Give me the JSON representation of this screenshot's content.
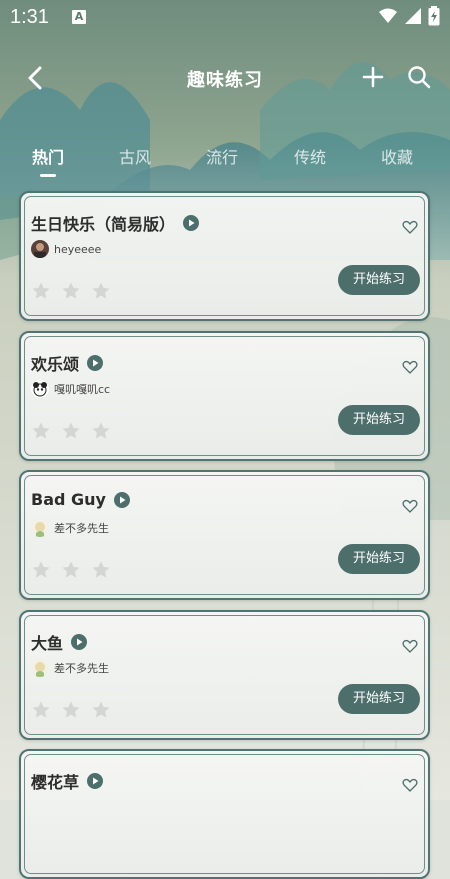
{
  "status_bar": {
    "time": "1:31",
    "notification_icon": "A"
  },
  "header": {
    "title": "趣味练习"
  },
  "tabs": [
    {
      "label": "热门",
      "active": true
    },
    {
      "label": "古风",
      "active": false
    },
    {
      "label": "流行",
      "active": false
    },
    {
      "label": "传统",
      "active": false
    },
    {
      "label": "收藏",
      "active": false
    }
  ],
  "cards": [
    {
      "title": "生日快乐（简易版）",
      "author": "heyeeee",
      "rating": 0,
      "button": "开始练习"
    },
    {
      "title": "欢乐颂",
      "author": "嘎叽嘎叽cc",
      "rating": 0,
      "button": "开始练习"
    },
    {
      "title": "Bad Guy",
      "author": "差不多先生",
      "rating": 0,
      "button": "开始练习"
    },
    {
      "title": "大鱼",
      "author": "差不多先生",
      "rating": 0,
      "button": "开始练习"
    },
    {
      "title": "樱花草",
      "author": "",
      "rating": 0,
      "button": ""
    }
  ],
  "colors": {
    "accent": "#4d6f6c",
    "card_border": "#4f7473",
    "star_empty": "#d4d6d3"
  }
}
